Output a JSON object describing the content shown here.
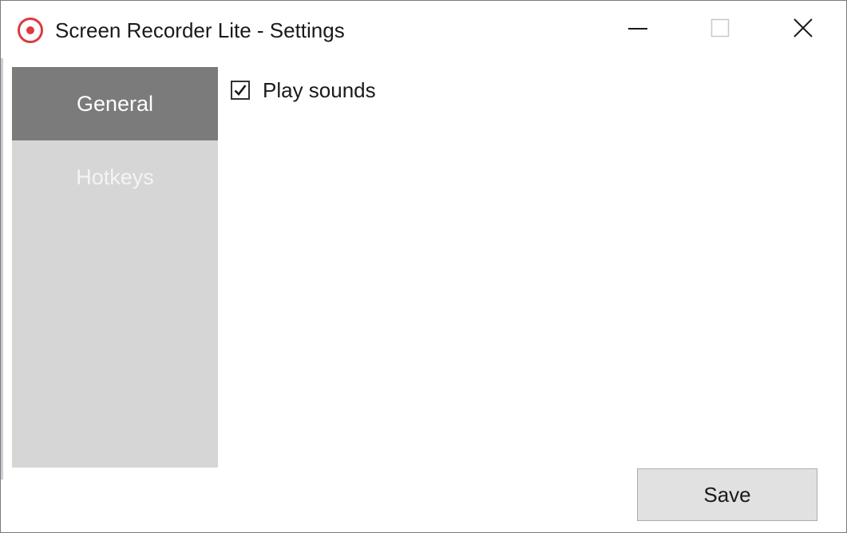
{
  "window": {
    "title": "Screen Recorder Lite - Settings",
    "app_icon": "record-icon",
    "controls": {
      "minimize_icon": "minimize-icon",
      "maximize_icon": "maximize-icon",
      "close_icon": "close-icon"
    }
  },
  "sidebar": {
    "items": [
      {
        "label": "General",
        "active": true
      },
      {
        "label": "Hotkeys",
        "active": false
      }
    ],
    "active_color": "#7b7b7b",
    "background_color": "#d6d6d6"
  },
  "general": {
    "play_sounds": {
      "label": "Play sounds",
      "checked": true
    }
  },
  "footer": {
    "save_label": "Save"
  },
  "colors": {
    "record_icon": "#e0393e"
  }
}
